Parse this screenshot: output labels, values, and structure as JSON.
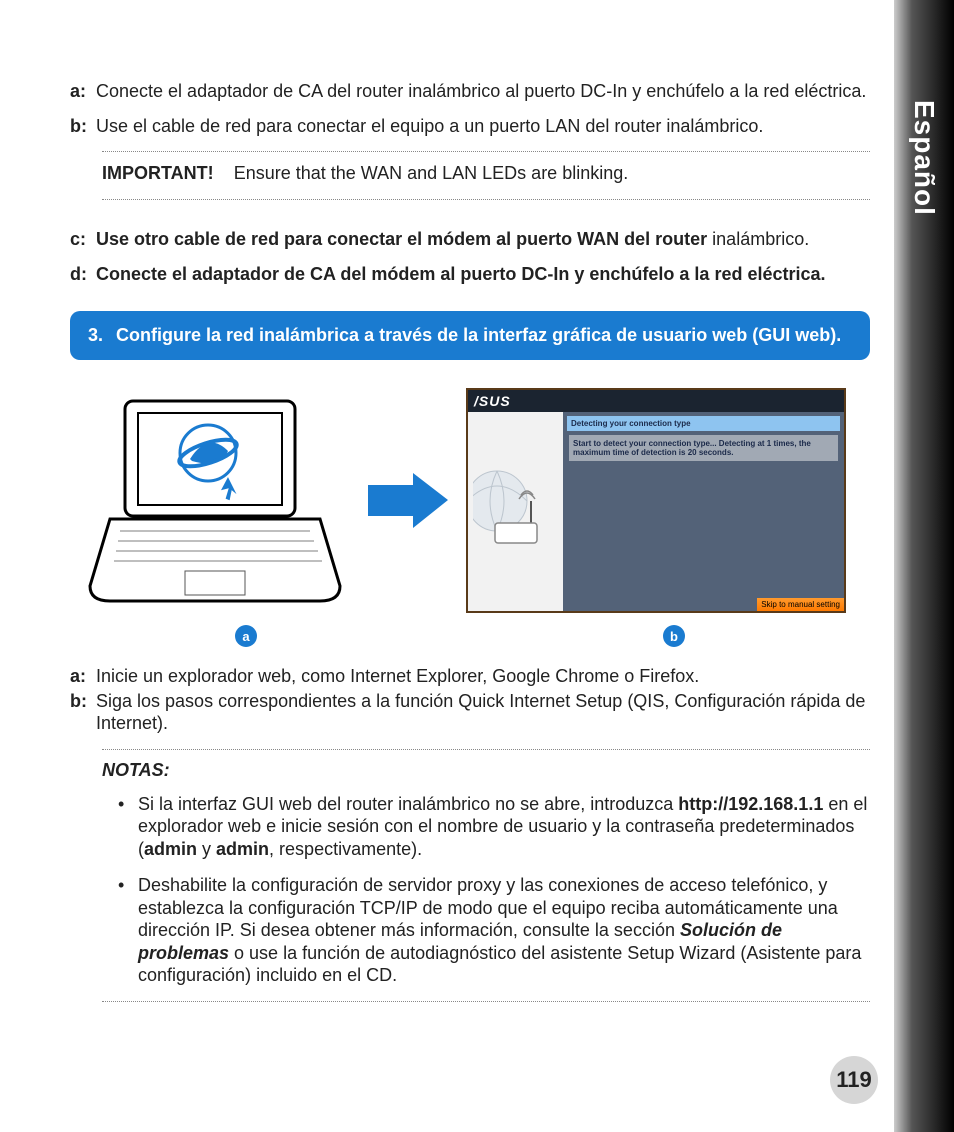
{
  "language_tab": "Español",
  "steps_top": {
    "a": "Conecte el adaptador de CA del router inalámbrico al puerto DC-In y enchúfelo a la red eléctrica.",
    "b": "Use el cable de red para conectar el equipo a un puerto LAN del router inalámbrico."
  },
  "important_label": "IMPORTANT!",
  "important_text": "Ensure that the WAN and LAN LEDs are blinking.",
  "steps_mid": {
    "c_bold": "Use otro cable de red para conectar el módem al puerto WAN del router",
    "c_rest": "inalámbrico.",
    "d_bold": "Conecte el adaptador de CA del módem al puerto DC-In y enchúfelo a la red eléctrica."
  },
  "blue_box": {
    "num": "3.",
    "text": "Configure la red inalámbrica a través de la interfaz gráfica de usuario web (GUI web)."
  },
  "router_screen": {
    "logo": "/SUS",
    "detect_bar": "Detecting your connection type",
    "detect_msg": "Start to detect your connection type... Detecting at 1 times, the maximum time of detection is 20 seconds.",
    "skip": "Skip to manual setting"
  },
  "badges": {
    "a": "a",
    "b": "b"
  },
  "steps_bottom": {
    "a": "Inicie un explorador web, como Internet Explorer, Google Chrome o Firefox.",
    "b": "Siga los pasos correspondientes a la función Quick Internet Setup (QIS, Configuración rápida de Internet)."
  },
  "notas_title": "NOTAS:",
  "notes": {
    "n1_pre": "Si la interfaz GUI web del router inalámbrico no se abre, introduzca ",
    "n1_url": "http://192.168.1.1",
    "n1_mid": " en el explorador web e inicie sesión con el nombre de usuario y la contraseña predeterminados (",
    "n1_admin1": "admin",
    "n1_y": " y ",
    "n1_admin2": "admin",
    "n1_end": ", respectivamente).",
    "n2_pre": "Deshabilite la configuración de servidor proxy y las conexiones de acceso telefónico, y establezca la configuración TCP/IP de modo que el equipo reciba automáticamente una dirección IP. Si desea obtener más información, consulte la sección ",
    "n2_bold": "Solución de problemas",
    "n2_end": " o use la función de autodiagnóstico del asistente Setup Wizard (Asistente para configuración) incluido en el CD."
  },
  "page_number": "119"
}
